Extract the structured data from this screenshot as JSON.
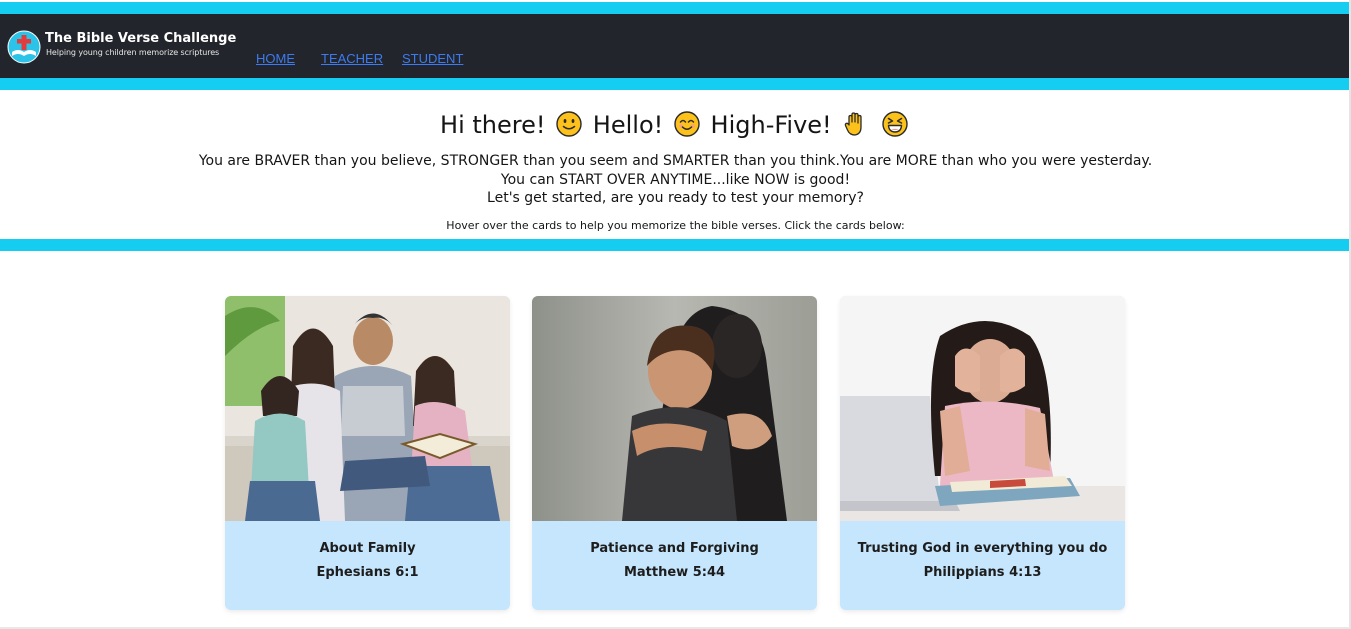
{
  "brand": {
    "title": "The Bible Verse Challenge",
    "tagline": "Helping young children memorize scriptures",
    "logo_icon": "bible-cross-logo-icon"
  },
  "nav": {
    "home": "HOME",
    "teacher": "TEACHER",
    "student": "STUDENT"
  },
  "hero": {
    "greeting_1": "Hi there!",
    "greeting_2": "Hello!",
    "greeting_3": "High-Five!",
    "emojis": [
      "slightly-smiling-face-icon",
      "smiling-face-icon",
      "raised-hand-icon",
      "grinning-squinting-face-icon"
    ],
    "line_1": "You are BRAVER than you believe, STRONGER than you seem and SMARTER than you think.You are MORE than who you were yesterday.",
    "line_2": "You can START OVER ANYTIME...like NOW is good!",
    "line_3": "Let's get started, are you ready to test your memory?",
    "instructions": "Hover over the cards to help you memorize the bible verses. Click the cards below:"
  },
  "cards": [
    {
      "title": "About Family",
      "verse": "Ephesians 6:1",
      "photo": "family-reading-bible-photo"
    },
    {
      "title": "Patience and Forgiving",
      "verse": "Matthew 5:44",
      "photo": "mother-hugging-child-photo"
    },
    {
      "title": "Trusting God in everything you do",
      "verse": "Philippians 4:13",
      "photo": "stressed-girl-studying-photo"
    }
  ],
  "colors": {
    "accent_cyan": "#14cdf0",
    "navbar": "#22252b",
    "nav_link": "#3c7bf0",
    "card_body": "#c5e6fd"
  }
}
